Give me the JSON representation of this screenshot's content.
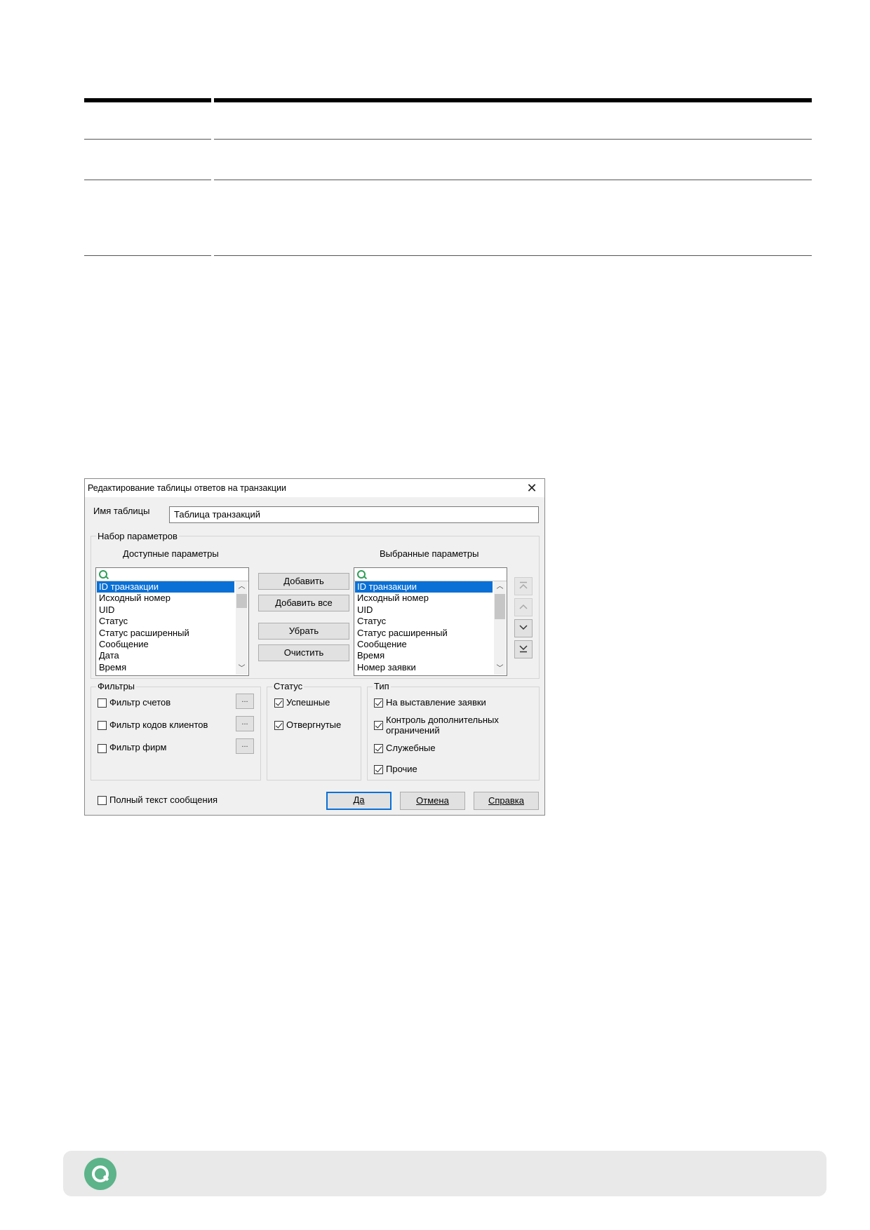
{
  "dialog": {
    "title": "Редактирование таблицы ответов на транзакции",
    "table_name_label": "Имя таблицы",
    "table_name_value": "Таблица транзакций",
    "param_group_title": "Набор параметров",
    "available_label": "Доступные параметры",
    "selected_label": "Выбранные параметры",
    "available_items": [
      "ID транзакции",
      "Исходный номер",
      "UID",
      "Статус",
      "Статус расширенный",
      "Сообщение",
      "Дата",
      "Время"
    ],
    "selected_items": [
      "ID транзакции",
      "Исходный номер",
      "UID",
      "Статус",
      "Статус расширенный",
      "Сообщение",
      "Время",
      "Номер заявки"
    ],
    "buttons": {
      "add": "Добавить",
      "add_all": "Добавить все",
      "remove": "Убрать",
      "clear": "Очистить",
      "ok": "Да",
      "cancel": "Отмена",
      "help": "Справка"
    },
    "filters": {
      "title": "Фильтры",
      "items": [
        {
          "label": "Фильтр счетов",
          "checked": false
        },
        {
          "label": "Фильтр кодов клиентов",
          "checked": false
        },
        {
          "label": "Фильтр фирм",
          "checked": false
        }
      ],
      "ellipsis": "..."
    },
    "status": {
      "title": "Статус",
      "items": [
        {
          "label": "Успешные",
          "checked": true
        },
        {
          "label": "Отвергнутые",
          "checked": true
        }
      ]
    },
    "type": {
      "title": "Тип",
      "items": [
        {
          "label": "На выставление заявки",
          "checked": true
        },
        {
          "label": "Контроль дополнительных",
          "label2": "ограничений",
          "checked": true
        },
        {
          "label": "Служебные",
          "checked": true
        },
        {
          "label": "Прочие",
          "checked": true
        }
      ]
    },
    "full_text": {
      "label": "Полный текст сообщения",
      "checked": false
    }
  },
  "colors": {
    "selection": "#0a70d6",
    "logo": "#5db38a",
    "footer_bg": "#e8e9e8"
  }
}
